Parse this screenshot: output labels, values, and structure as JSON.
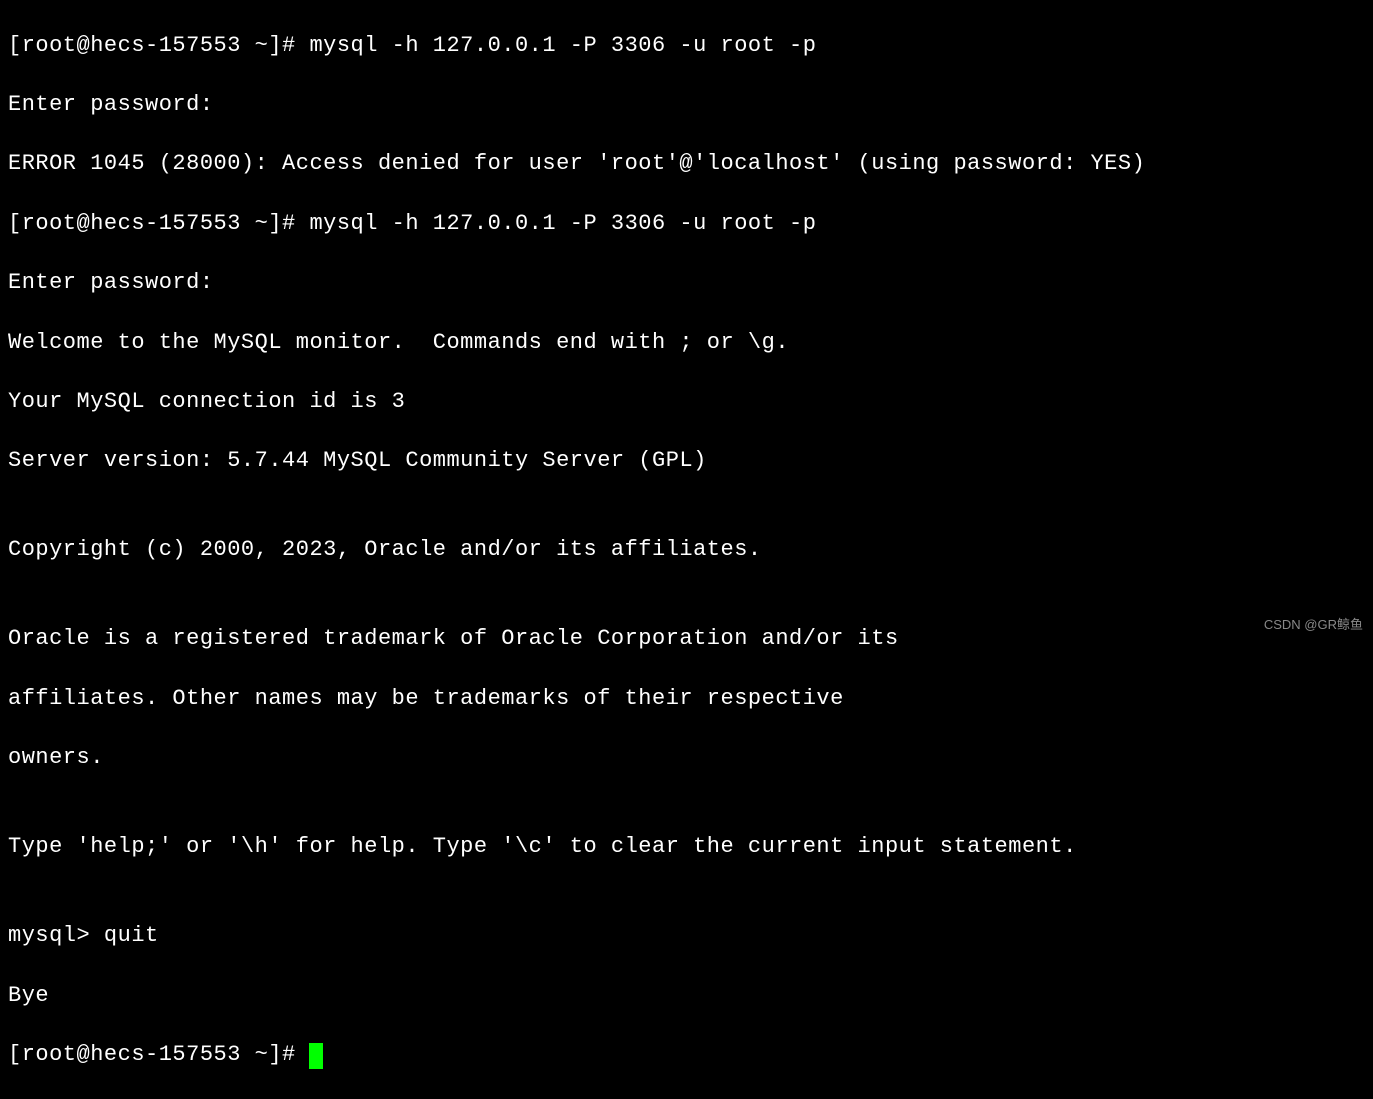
{
  "terminal": {
    "lines": [
      "[root@hecs-157553 ~]# mysql -h 127.0.0.1 -P 3306 -u root -p",
      "Enter password:",
      "ERROR 1045 (28000): Access denied for user 'root'@'localhost' (using password: YES)",
      "[root@hecs-157553 ~]# mysql -h 127.0.0.1 -P 3306 -u root -p",
      "Enter password:",
      "Welcome to the MySQL monitor.  Commands end with ; or \\g.",
      "Your MySQL connection id is 3",
      "Server version: 5.7.44 MySQL Community Server (GPL)",
      "",
      "Copyright (c) 2000, 2023, Oracle and/or its affiliates.",
      "",
      "Oracle is a registered trademark of Oracle Corporation and/or its",
      "affiliates. Other names may be trademarks of their respective",
      "owners.",
      "",
      "Type 'help;' or '\\h' for help. Type '\\c' to clear the current input statement.",
      "",
      "mysql> quit",
      "Bye"
    ],
    "final_prompt": "[root@hecs-157553 ~]# "
  },
  "watermark": "CSDN @GR鲸鱼"
}
